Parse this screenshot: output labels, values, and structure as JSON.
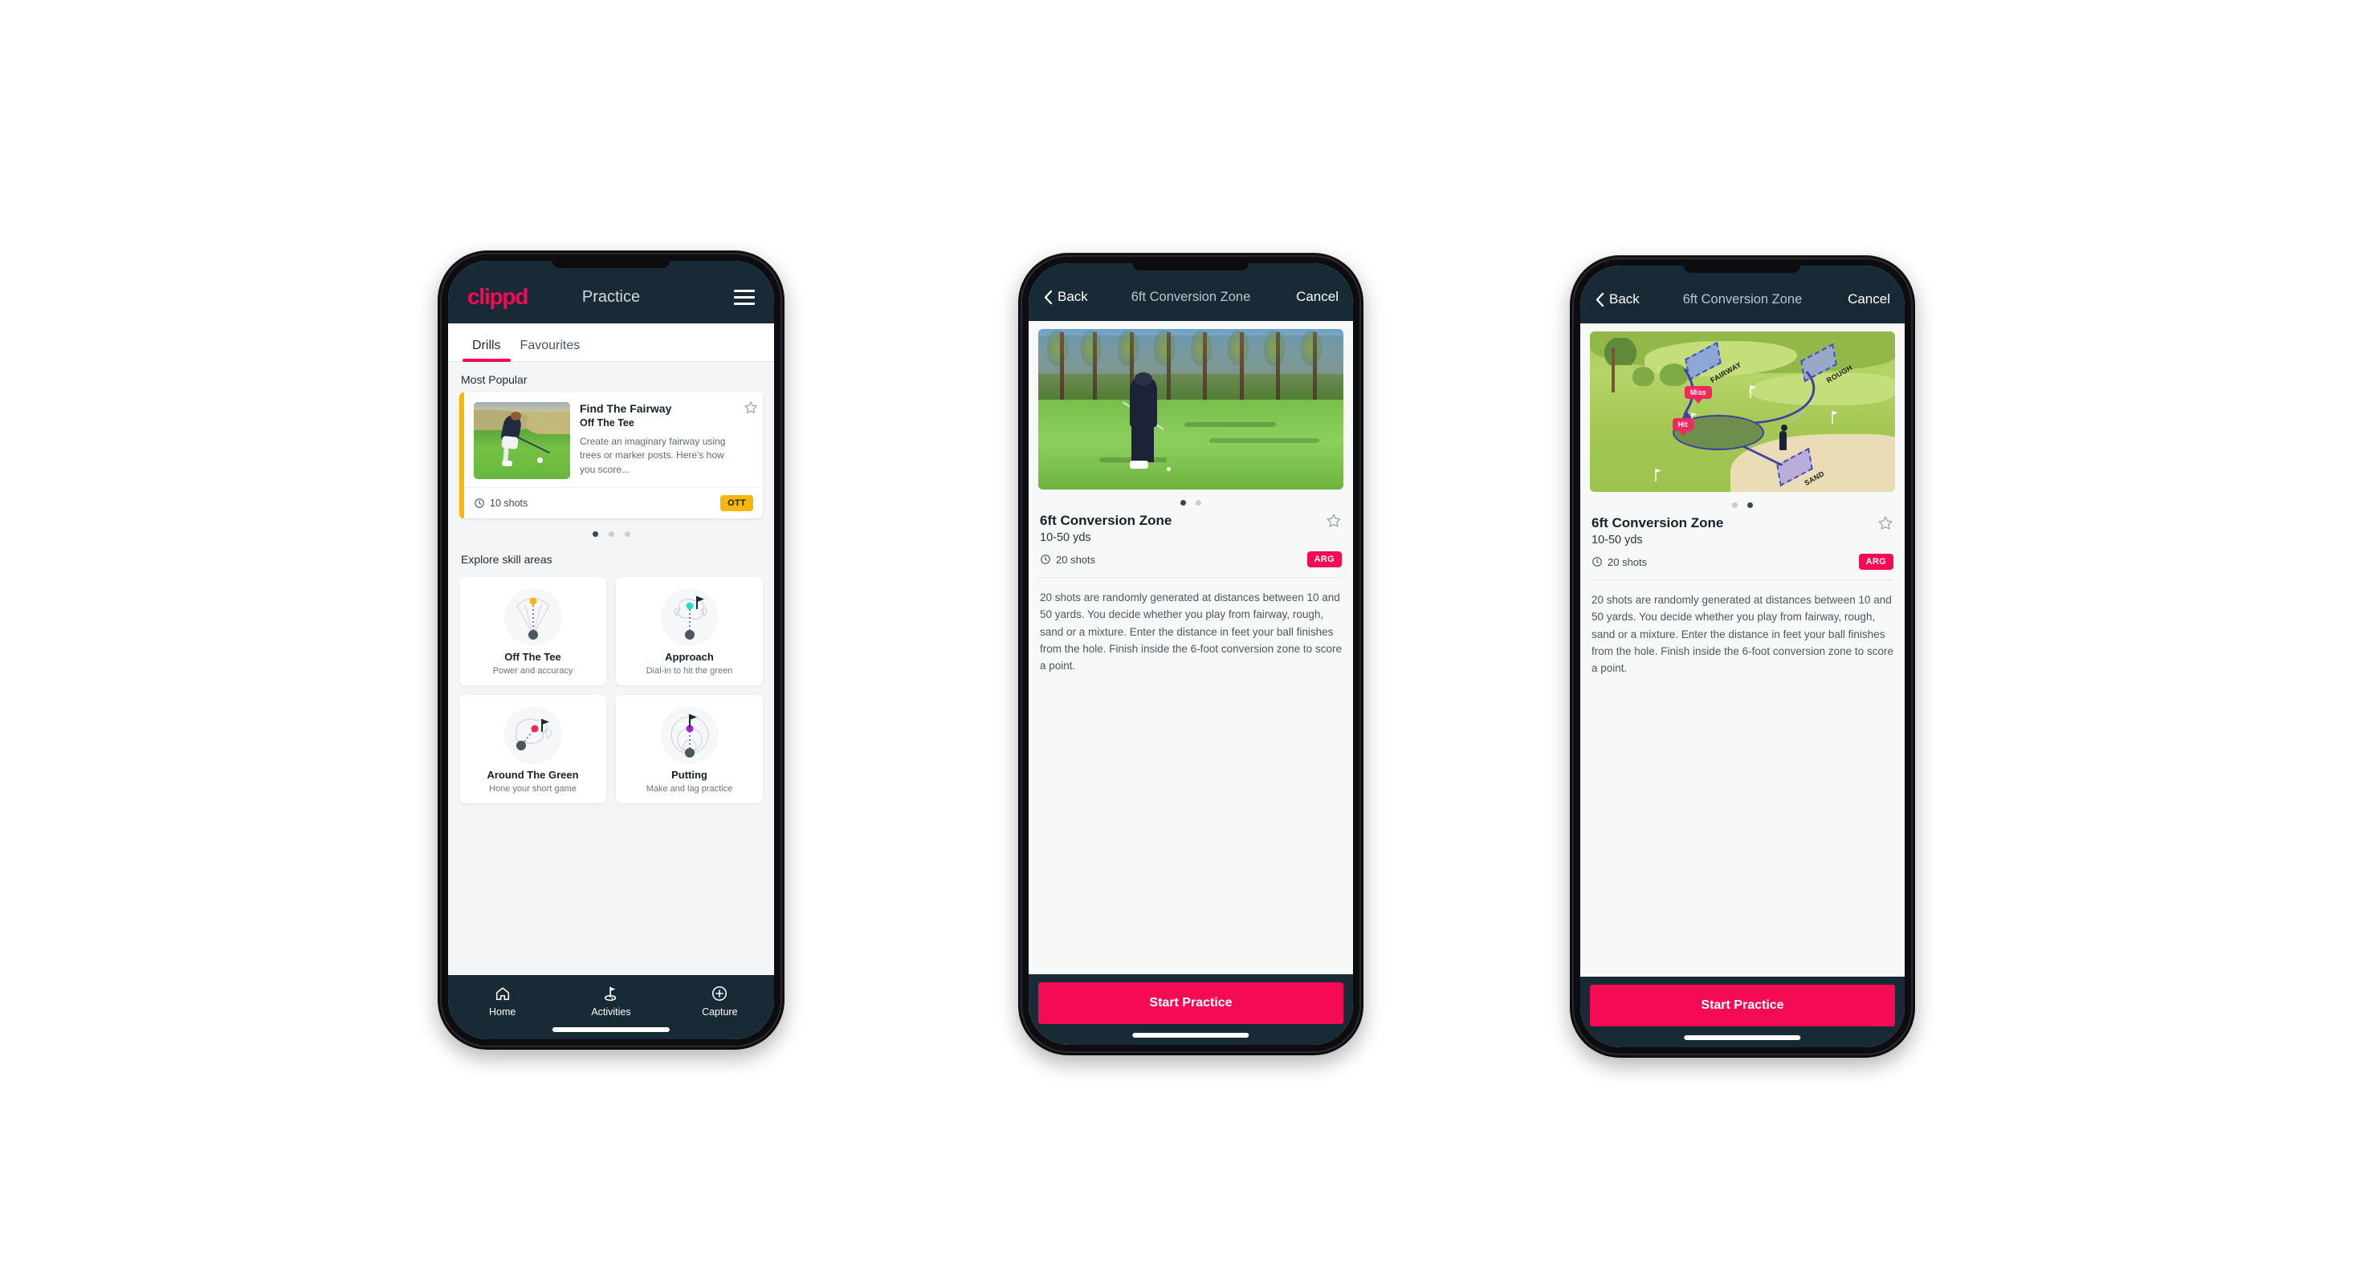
{
  "phone1": {
    "header": {
      "brand": "clippd",
      "title": "Practice",
      "menu_icon": "hamburger-icon"
    },
    "tabs": [
      {
        "label": "Drills",
        "active": true
      },
      {
        "label": "Favourites",
        "active": false
      }
    ],
    "section_most_popular": "Most Popular",
    "popular_card": {
      "title": "Find The Fairway",
      "subtitle": "Off The Tee",
      "description": "Create an imaginary fairway using trees or marker posts. Here's how you score...",
      "shots": "10 shots",
      "pill": "OTT",
      "pill_color": "#f5b70a",
      "accent_color": "#f5b70a",
      "peek_color": "#27dfc0",
      "star_icon": "star-outline-icon",
      "clock_icon": "clock-icon"
    },
    "carousel_dots": {
      "count": 3,
      "active_index": 0
    },
    "section_skill_areas": "Explore skill areas",
    "skill_cards": [
      {
        "name": "Off The Tee",
        "desc": "Power and accuracy",
        "icon": "tee-dispersion-icon",
        "marker_color": "#f5b70a"
      },
      {
        "name": "Approach",
        "desc": "Dial-in to hit the green",
        "icon": "approach-green-icon",
        "marker_color": "#27dfc0"
      },
      {
        "name": "Around The Green",
        "desc": "Hone your short game",
        "icon": "chipping-green-icon",
        "marker_color": "#f2295b"
      },
      {
        "name": "Putting",
        "desc": "Make and lag practice",
        "icon": "putting-rings-icon",
        "marker_color": "#a61fd4"
      }
    ],
    "bottom_nav": [
      {
        "label": "Home",
        "icon": "home-icon",
        "active": false
      },
      {
        "label": "Activities",
        "icon": "golf-flag-icon",
        "active": true
      },
      {
        "label": "Capture",
        "icon": "plus-circle-icon",
        "active": false
      }
    ]
  },
  "phone2": {
    "header": {
      "back_label": "Back",
      "back_icon": "chevron-left-icon",
      "title": "6ft Conversion Zone",
      "cancel_label": "Cancel"
    },
    "hero": {
      "type": "photo",
      "alt": "golfer-chipping-photo"
    },
    "carousel_dots": {
      "count": 2,
      "active_index": 0
    },
    "drill": {
      "name": "6ft Conversion Zone",
      "distance": "10-50 yds",
      "shots": "20 shots",
      "pill": "ARG",
      "pill_color": "#f50a54",
      "star_icon": "star-outline-icon",
      "clock_icon": "clock-icon",
      "description": "20 shots are randomly generated at distances between 10 and 50 yards. You decide whether you play from fairway, rough, sand or a mixture. Enter the distance in feet your ball finishes from the hole. Finish inside the 6-foot conversion zone to score a point."
    },
    "cta_label": "Start Practice"
  },
  "phone3": {
    "header": {
      "back_label": "Back",
      "back_icon": "chevron-left-icon",
      "title": "6ft Conversion Zone",
      "cancel_label": "Cancel"
    },
    "hero": {
      "type": "illustration",
      "alt": "course-map-illustration",
      "zone_labels": [
        "FAIRWAY",
        "ROUGH",
        "SAND"
      ],
      "tags": [
        "Miss",
        "Hit"
      ]
    },
    "carousel_dots": {
      "count": 2,
      "active_index": 1
    },
    "drill": {
      "name": "6ft Conversion Zone",
      "distance": "10-50 yds",
      "shots": "20 shots",
      "pill": "ARG",
      "pill_color": "#f50a54",
      "star_icon": "star-outline-icon",
      "clock_icon": "clock-icon",
      "description": "20 shots are randomly generated at distances between 10 and 50 yards. You decide whether you play from fairway, rough, sand or a mixture. Enter the distance in feet your ball finishes from the hole. Finish inside the 6-foot conversion zone to score a point."
    },
    "cta_label": "Start Practice"
  }
}
